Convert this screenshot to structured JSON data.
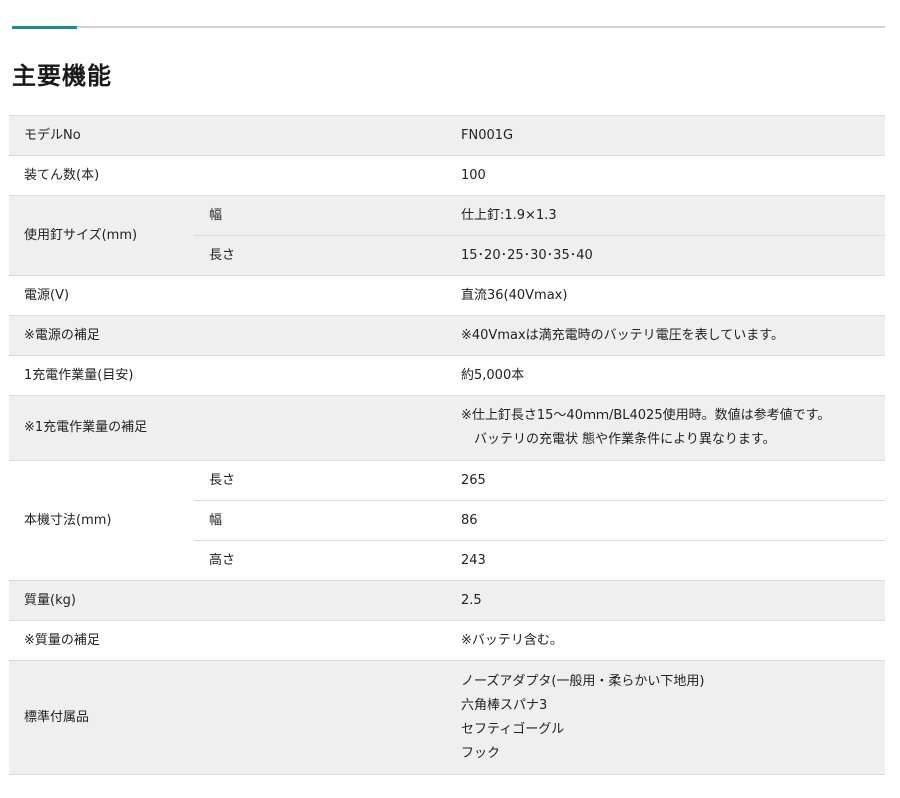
{
  "title": "主要機能",
  "rows": {
    "model": {
      "label": "モデルNo",
      "value": "FN001G"
    },
    "capacity": {
      "label": "装てん数(本)",
      "value": "100"
    },
    "nail_size": {
      "label": "使用釘サイズ(mm)",
      "width": {
        "label": "幅",
        "value": "仕上釘:1.9×1.3"
      },
      "length": {
        "label": "長さ",
        "value": "15･20･25･30･35･40"
      }
    },
    "power": {
      "label": "電源(V)",
      "value": "直流36(40Vmax)"
    },
    "power_note": {
      "label": "※電源の補足",
      "value": "※40Vmaxは満充電時のバッテリ電圧を表しています。"
    },
    "work_amount": {
      "label": "1充電作業量(目安)",
      "value": "約5,000本"
    },
    "work_note": {
      "label": "※1充電作業量の補足",
      "line1": "※仕上釘長さ15～40ｍｍ/BL4025使用時。数値は参考値です。",
      "line2": "　バッテリの充電状 態や作業条件により異なります。"
    },
    "dimensions": {
      "label": "本機寸法(mm)",
      "length": {
        "label": "長さ",
        "value": "265"
      },
      "width": {
        "label": "幅",
        "value": "86"
      },
      "height": {
        "label": "高さ",
        "value": "243"
      }
    },
    "mass": {
      "label": "質量(kg)",
      "value": "2.5"
    },
    "mass_note": {
      "label": "※質量の補足",
      "value": "※バッテリ含む。"
    },
    "accessories": {
      "label": "標準付属品",
      "items": [
        "ノーズアダプタ(一般用・柔らかい下地用)",
        "六角棒スパナ3",
        "セフティゴーグル",
        "フック"
      ]
    }
  }
}
